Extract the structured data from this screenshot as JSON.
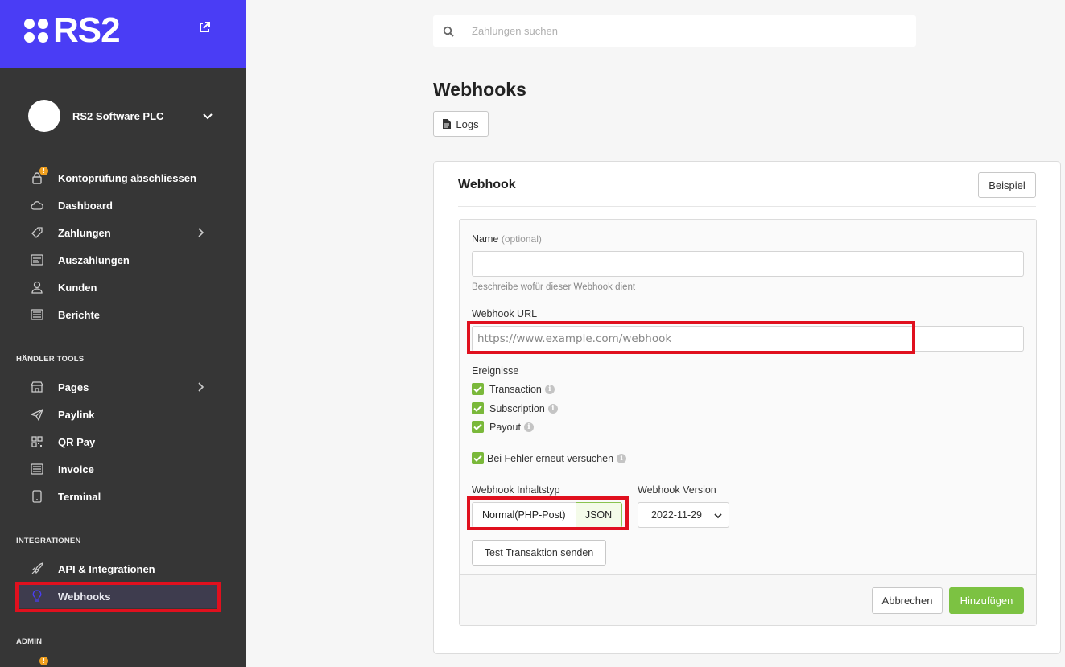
{
  "brand": {
    "logo_text": "RS2",
    "color": "#4a3df5"
  },
  "account": {
    "name": "RS2 Software PLC"
  },
  "sidebar": {
    "items": [
      {
        "label": "Kontoprüfung abschliessen",
        "icon": "lock-icon",
        "badge": "!"
      },
      {
        "label": "Dashboard",
        "icon": "cloud-icon"
      },
      {
        "label": "Zahlungen",
        "icon": "tag-icon"
      },
      {
        "label": "Auszahlungen",
        "icon": "payout-icon"
      },
      {
        "label": "Kunden",
        "icon": "user-icon"
      },
      {
        "label": "Berichte",
        "icon": "report-icon"
      }
    ],
    "section_tools": "HÄNDLER TOOLS",
    "tools": [
      {
        "label": "Pages",
        "icon": "store-icon"
      },
      {
        "label": "Paylink",
        "icon": "send-icon"
      },
      {
        "label": "QR Pay",
        "icon": "qr-icon"
      },
      {
        "label": "Invoice",
        "icon": "invoice-icon"
      },
      {
        "label": "Terminal",
        "icon": "terminal-icon"
      }
    ],
    "section_integrations": "INTEGRATIONEN",
    "integrations": [
      {
        "label": "API & Integrationen",
        "icon": "rocket-icon"
      },
      {
        "label": "Webhooks",
        "icon": "bulb-icon",
        "active": true
      }
    ],
    "section_admin": "ADMIN"
  },
  "search": {
    "placeholder": "Zahlungen suchen"
  },
  "page": {
    "title": "Webhooks",
    "logs_label": "Logs"
  },
  "card": {
    "title": "Webhook",
    "example_label": "Beispiel",
    "name_label": "Name",
    "name_optional": "(optional)",
    "name_value": "",
    "name_help": "Beschreibe wofür dieser Webhook dient",
    "url_label": "Webhook URL",
    "url_placeholder": "https://www.example.com/webhook",
    "events_label": "Ereignisse",
    "events": [
      {
        "label": "Transaction",
        "checked": true
      },
      {
        "label": "Subscription",
        "checked": true
      },
      {
        "label": "Payout",
        "checked": true
      }
    ],
    "retry_label": "Bei Fehler erneut versuchen",
    "retry_checked": true,
    "content_type_label": "Webhook Inhaltstyp",
    "content_type_options": [
      "Normal(PHP-Post)",
      "JSON"
    ],
    "content_type_selected": "JSON",
    "version_label": "Webhook Version",
    "version_value": "2022-11-29",
    "test_label": "Test Transaktion senden",
    "cancel_label": "Abbrechen",
    "add_label": "Hinzufügen"
  },
  "colors": {
    "accent_green": "#7cc242",
    "highlight_red": "#e0101e",
    "sidebar_bg": "#363636"
  }
}
